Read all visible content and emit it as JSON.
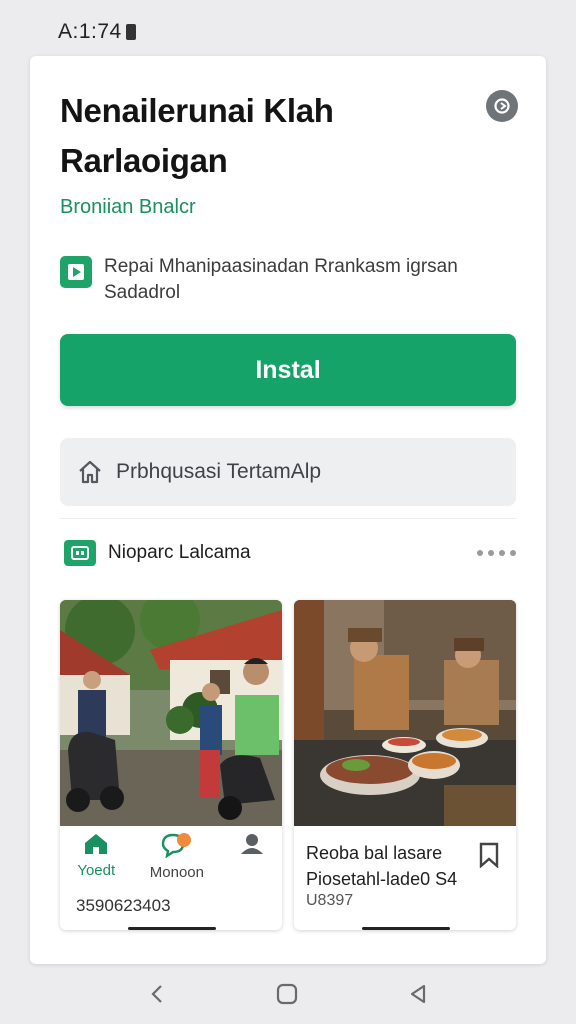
{
  "status_bar": {
    "time": "A:1:74"
  },
  "app": {
    "title": "Nenailerunai Klah Rarlaoigan",
    "developer": "Broniian Bnalcr",
    "description": "Repai Mhanipaasinadan Rrankasm igrsan Sadadrol"
  },
  "buttons": {
    "install": "Instal",
    "secondary": "Prbhqusasi TertamAlp"
  },
  "section": {
    "title": "Nioparc Lalcama"
  },
  "cards": [
    {
      "actions": [
        {
          "label": "Yoedt",
          "icon": "home-icon"
        },
        {
          "label": "Monoon",
          "icon": "chat-icon"
        },
        {
          "label": "",
          "icon": "person-icon"
        }
      ],
      "number": "3590623403"
    },
    {
      "title": "Reoba bal lasare Piosetahl-lade0 S4",
      "subtitle": "U8397",
      "icon": "bookmark-icon"
    }
  ],
  "colors": {
    "accent": "#16a36a",
    "developer_text": "#1a8f5f"
  }
}
